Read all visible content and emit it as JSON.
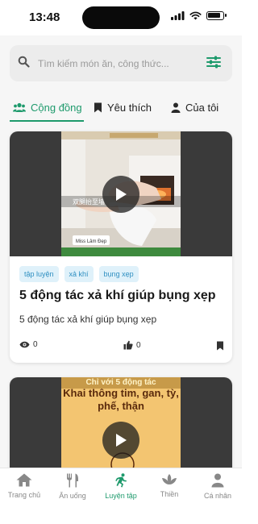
{
  "status": {
    "time": "13:48"
  },
  "search": {
    "placeholder": "Tìm kiếm món ăn, công thức..."
  },
  "tabs": [
    {
      "label": "Cộng đồng",
      "icon": "users-icon",
      "active": true
    },
    {
      "label": "Yêu thích",
      "icon": "bookmark-icon",
      "active": false
    },
    {
      "label": "Của tôi",
      "icon": "user-icon",
      "active": false
    }
  ],
  "posts": [
    {
      "tags": [
        "tập luyện",
        "xả khí",
        "bụng xẹp"
      ],
      "title": "5 động tác xả khí giúp bụng xẹp",
      "description": "5 động tác xả khí giúp bụng xẹp",
      "views": "0",
      "likes": "0",
      "thumb_caption": "Miss Lâm Đẹp"
    },
    {
      "thumb_banner_top": "Chỉ với 5 động tác",
      "thumb_banner_main": "Khai thông tim, gan, tỳ, phế, thận"
    }
  ],
  "bottom_nav": [
    {
      "label": "Trang chủ",
      "icon": "home-icon",
      "active": false
    },
    {
      "label": "Ăn uống",
      "icon": "utensils-icon",
      "active": false
    },
    {
      "label": "Luyện tập",
      "icon": "running-icon",
      "active": true
    },
    {
      "label": "Thiền",
      "icon": "lotus-icon",
      "active": false
    },
    {
      "label": "Cá nhân",
      "icon": "profile-icon",
      "active": false
    }
  ],
  "colors": {
    "accent": "#1e9a6c",
    "tag_bg": "#dff1fa",
    "tag_text": "#2f8fc1"
  }
}
